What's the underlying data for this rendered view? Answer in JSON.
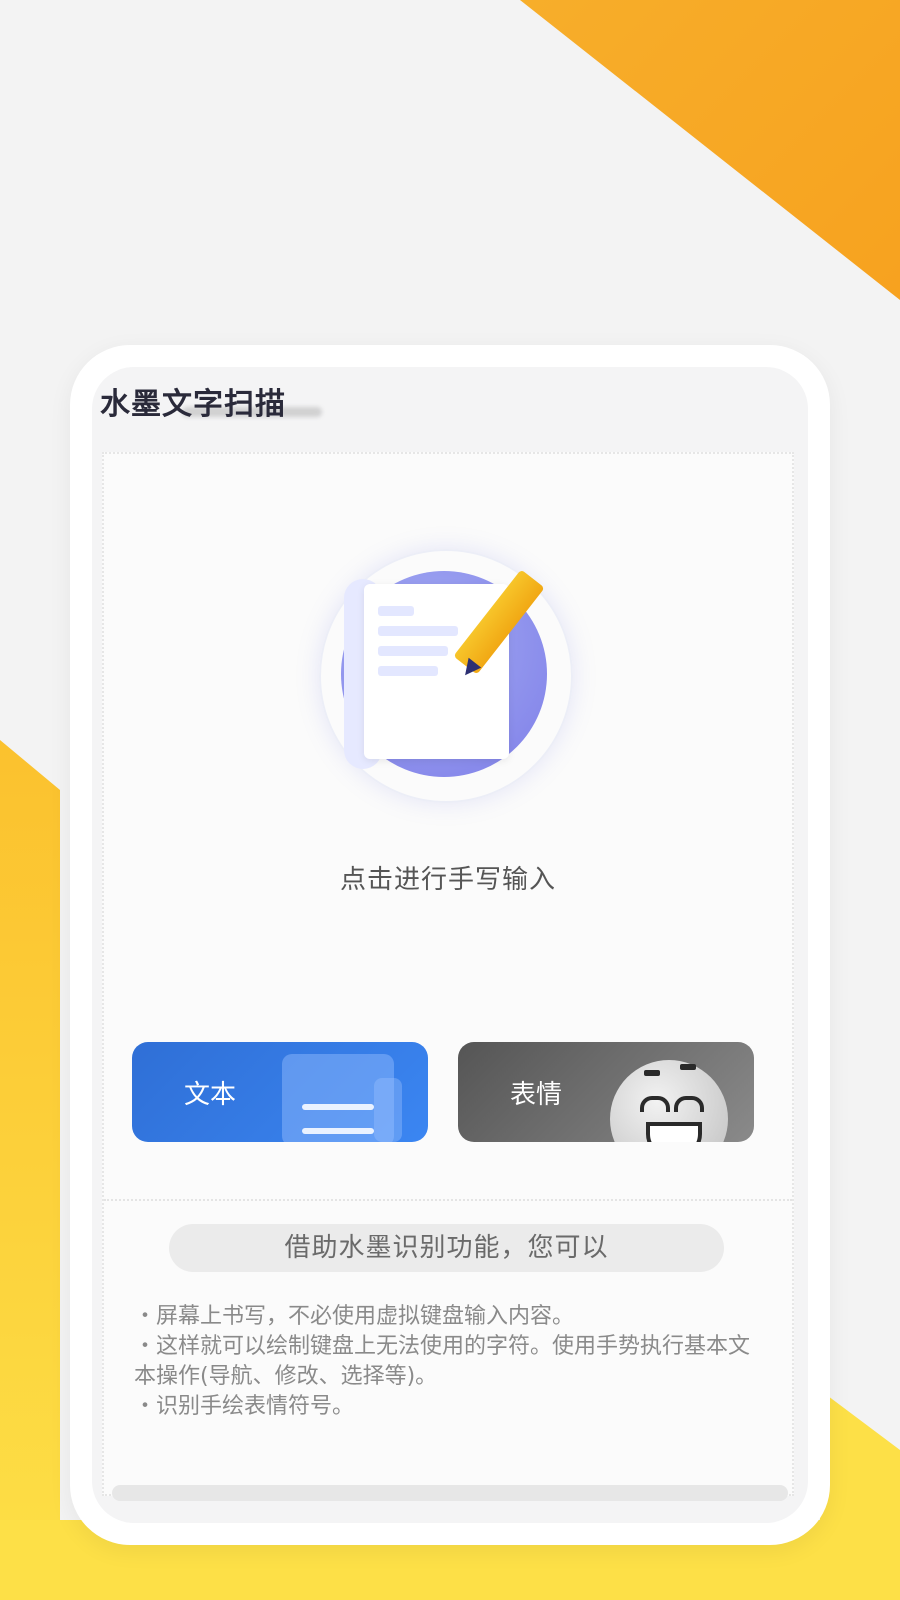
{
  "colors": {
    "accent_orange": "#f7b733",
    "accent_yellow": "#fde047",
    "text_button_blue": "#2f6fd6",
    "emoji_button_gray": "#6a6a6a",
    "icon_purple": "#7e7ee8"
  },
  "header": {
    "title": "水墨文字扫描"
  },
  "main": {
    "prompt": "点击进行手写输入",
    "icon": "handwriting-scroll-pencil-icon"
  },
  "modes": {
    "text_label": "文本",
    "emoji_label": "表情"
  },
  "features": {
    "heading": "借助水墨识别功能，您可以",
    "items": [
      "・屏幕上书写，不必使用虚拟键盘输入内容。",
      "・这样就可以绘制键盘上无法使用的字符。使用手势执行基本文本操作(导航、修改、选择等)。",
      "・识别手绘表情符号。"
    ]
  }
}
